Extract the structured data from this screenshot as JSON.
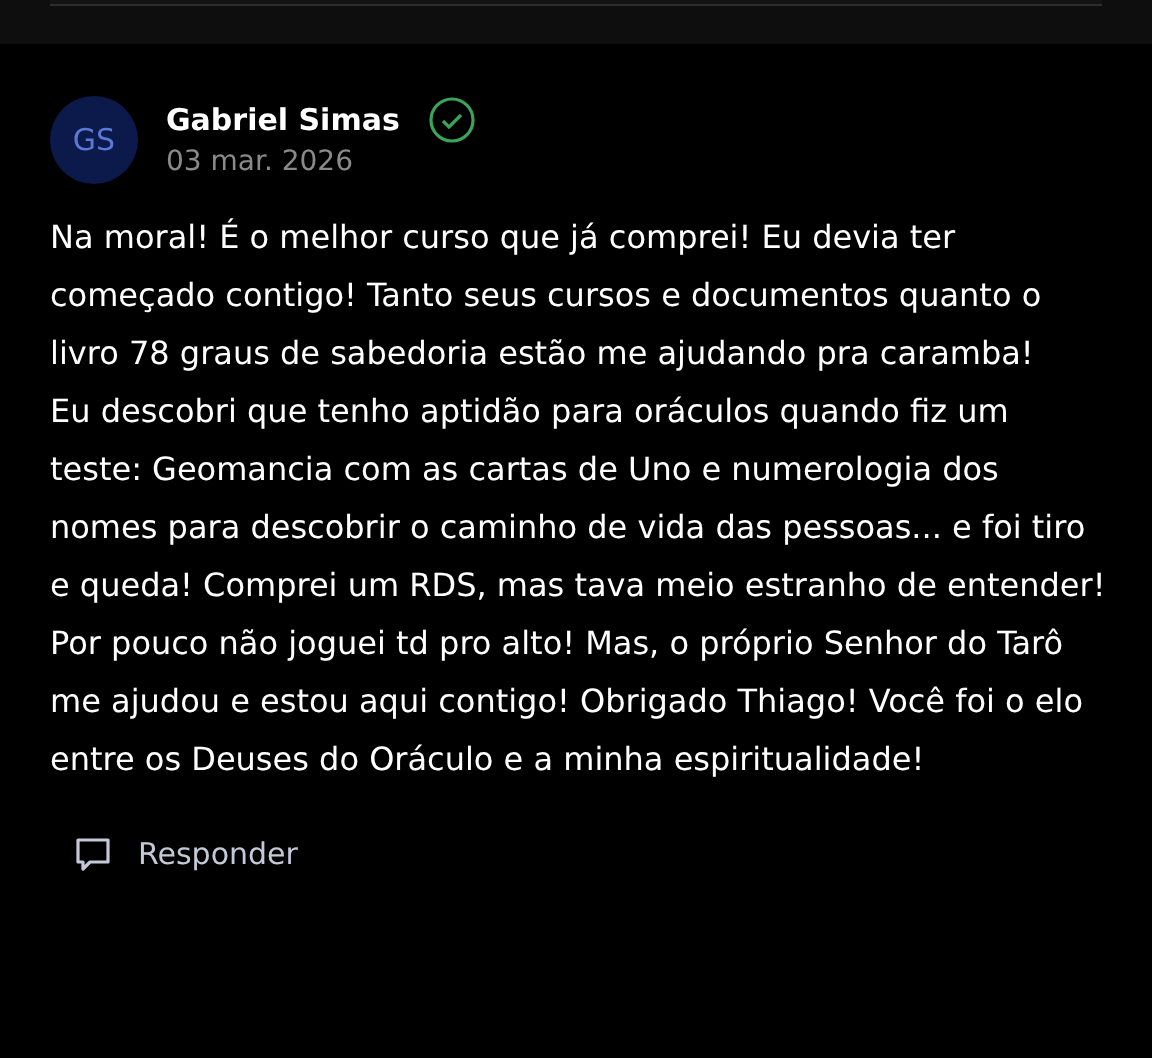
{
  "comment": {
    "initials": "GS",
    "author": "Gabriel Simas",
    "verified": true,
    "date": "03 mar. 2026",
    "paragraphs": [
      "Na moral! É o melhor curso que já comprei! Eu devia ter começado contigo! Tanto seus cursos e documentos quanto o livro 78 graus de sabedoria estão me ajudando pra caramba!",
      "Eu descobri que tenho aptidão para oráculos quando fiz um teste: Geomancia com as cartas de Uno e numerologia dos nomes para descobrir o caminho de vida das pessoas... e foi tiro e queda! Comprei um RDS, mas tava meio estranho de entender! Por pouco não joguei td pro alto! Mas, o próprio Senhor do Tarô me ajudou e estou aqui contigo! Obrigado Thiago! Você foi o elo entre os Deuses do Oráculo e a minha espiritualidade!"
    ],
    "reply_label": "Responder"
  }
}
